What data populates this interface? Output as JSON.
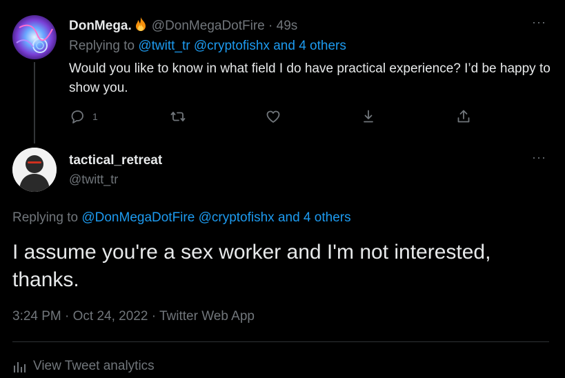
{
  "tweet1": {
    "display_name": "DonMega.",
    "name_emoji_icon": "fire-icon",
    "handle": "@DonMegaDotFire",
    "separator": "·",
    "time": "49s",
    "replying_to_prefix": "Replying to",
    "replying_to_links": "@twitt_tr @cryptofishx and 4 others",
    "text": "Would you like to know in what field I do have practical experience? I’d be happy to show you.",
    "reply_count": "1",
    "more": "···",
    "actions": [
      "reply-icon",
      "retweet-icon",
      "like-icon",
      "download-icon",
      "share-icon"
    ]
  },
  "tweet2": {
    "display_name": "tactical_retreat",
    "handle": "@twitt_tr",
    "more": "···",
    "replying_to_prefix": "Replying to",
    "replying_to_links": "@DonMegaDotFire @cryptofishx and 4 others",
    "text": "I assume you're a sex worker and I'm not interested, thanks.",
    "timestamp": "3:24 PM · Oct 24, 2022 · Twitter Web App",
    "analytics_label": "View Tweet analytics"
  },
  "colors": {
    "background": "#000000",
    "text": "#e7e9ea",
    "muted": "#71767b",
    "link": "#1d9bf0",
    "divider": "#2f3336"
  }
}
